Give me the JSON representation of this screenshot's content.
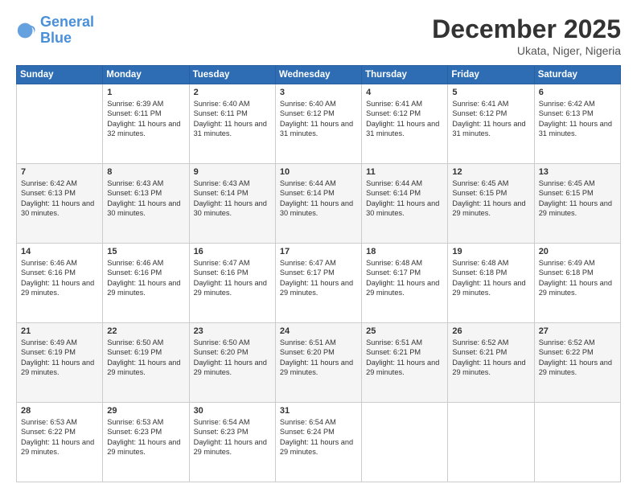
{
  "header": {
    "logo_line1": "General",
    "logo_line2": "Blue",
    "month_title": "December 2025",
    "location": "Ukata, Niger, Nigeria"
  },
  "weekdays": [
    "Sunday",
    "Monday",
    "Tuesday",
    "Wednesday",
    "Thursday",
    "Friday",
    "Saturday"
  ],
  "weeks": [
    [
      {
        "day": "",
        "sunrise": "",
        "sunset": "",
        "daylight": ""
      },
      {
        "day": "1",
        "sunrise": "Sunrise: 6:39 AM",
        "sunset": "Sunset: 6:11 PM",
        "daylight": "Daylight: 11 hours and 32 minutes."
      },
      {
        "day": "2",
        "sunrise": "Sunrise: 6:40 AM",
        "sunset": "Sunset: 6:11 PM",
        "daylight": "Daylight: 11 hours and 31 minutes."
      },
      {
        "day": "3",
        "sunrise": "Sunrise: 6:40 AM",
        "sunset": "Sunset: 6:12 PM",
        "daylight": "Daylight: 11 hours and 31 minutes."
      },
      {
        "day": "4",
        "sunrise": "Sunrise: 6:41 AM",
        "sunset": "Sunset: 6:12 PM",
        "daylight": "Daylight: 11 hours and 31 minutes."
      },
      {
        "day": "5",
        "sunrise": "Sunrise: 6:41 AM",
        "sunset": "Sunset: 6:12 PM",
        "daylight": "Daylight: 11 hours and 31 minutes."
      },
      {
        "day": "6",
        "sunrise": "Sunrise: 6:42 AM",
        "sunset": "Sunset: 6:13 PM",
        "daylight": "Daylight: 11 hours and 31 minutes."
      }
    ],
    [
      {
        "day": "7",
        "sunrise": "Sunrise: 6:42 AM",
        "sunset": "Sunset: 6:13 PM",
        "daylight": "Daylight: 11 hours and 30 minutes."
      },
      {
        "day": "8",
        "sunrise": "Sunrise: 6:43 AM",
        "sunset": "Sunset: 6:13 PM",
        "daylight": "Daylight: 11 hours and 30 minutes."
      },
      {
        "day": "9",
        "sunrise": "Sunrise: 6:43 AM",
        "sunset": "Sunset: 6:14 PM",
        "daylight": "Daylight: 11 hours and 30 minutes."
      },
      {
        "day": "10",
        "sunrise": "Sunrise: 6:44 AM",
        "sunset": "Sunset: 6:14 PM",
        "daylight": "Daylight: 11 hours and 30 minutes."
      },
      {
        "day": "11",
        "sunrise": "Sunrise: 6:44 AM",
        "sunset": "Sunset: 6:14 PM",
        "daylight": "Daylight: 11 hours and 30 minutes."
      },
      {
        "day": "12",
        "sunrise": "Sunrise: 6:45 AM",
        "sunset": "Sunset: 6:15 PM",
        "daylight": "Daylight: 11 hours and 29 minutes."
      },
      {
        "day": "13",
        "sunrise": "Sunrise: 6:45 AM",
        "sunset": "Sunset: 6:15 PM",
        "daylight": "Daylight: 11 hours and 29 minutes."
      }
    ],
    [
      {
        "day": "14",
        "sunrise": "Sunrise: 6:46 AM",
        "sunset": "Sunset: 6:16 PM",
        "daylight": "Daylight: 11 hours and 29 minutes."
      },
      {
        "day": "15",
        "sunrise": "Sunrise: 6:46 AM",
        "sunset": "Sunset: 6:16 PM",
        "daylight": "Daylight: 11 hours and 29 minutes."
      },
      {
        "day": "16",
        "sunrise": "Sunrise: 6:47 AM",
        "sunset": "Sunset: 6:16 PM",
        "daylight": "Daylight: 11 hours and 29 minutes."
      },
      {
        "day": "17",
        "sunrise": "Sunrise: 6:47 AM",
        "sunset": "Sunset: 6:17 PM",
        "daylight": "Daylight: 11 hours and 29 minutes."
      },
      {
        "day": "18",
        "sunrise": "Sunrise: 6:48 AM",
        "sunset": "Sunset: 6:17 PM",
        "daylight": "Daylight: 11 hours and 29 minutes."
      },
      {
        "day": "19",
        "sunrise": "Sunrise: 6:48 AM",
        "sunset": "Sunset: 6:18 PM",
        "daylight": "Daylight: 11 hours and 29 minutes."
      },
      {
        "day": "20",
        "sunrise": "Sunrise: 6:49 AM",
        "sunset": "Sunset: 6:18 PM",
        "daylight": "Daylight: 11 hours and 29 minutes."
      }
    ],
    [
      {
        "day": "21",
        "sunrise": "Sunrise: 6:49 AM",
        "sunset": "Sunset: 6:19 PM",
        "daylight": "Daylight: 11 hours and 29 minutes."
      },
      {
        "day": "22",
        "sunrise": "Sunrise: 6:50 AM",
        "sunset": "Sunset: 6:19 PM",
        "daylight": "Daylight: 11 hours and 29 minutes."
      },
      {
        "day": "23",
        "sunrise": "Sunrise: 6:50 AM",
        "sunset": "Sunset: 6:20 PM",
        "daylight": "Daylight: 11 hours and 29 minutes."
      },
      {
        "day": "24",
        "sunrise": "Sunrise: 6:51 AM",
        "sunset": "Sunset: 6:20 PM",
        "daylight": "Daylight: 11 hours and 29 minutes."
      },
      {
        "day": "25",
        "sunrise": "Sunrise: 6:51 AM",
        "sunset": "Sunset: 6:21 PM",
        "daylight": "Daylight: 11 hours and 29 minutes."
      },
      {
        "day": "26",
        "sunrise": "Sunrise: 6:52 AM",
        "sunset": "Sunset: 6:21 PM",
        "daylight": "Daylight: 11 hours and 29 minutes."
      },
      {
        "day": "27",
        "sunrise": "Sunrise: 6:52 AM",
        "sunset": "Sunset: 6:22 PM",
        "daylight": "Daylight: 11 hours and 29 minutes."
      }
    ],
    [
      {
        "day": "28",
        "sunrise": "Sunrise: 6:53 AM",
        "sunset": "Sunset: 6:22 PM",
        "daylight": "Daylight: 11 hours and 29 minutes."
      },
      {
        "day": "29",
        "sunrise": "Sunrise: 6:53 AM",
        "sunset": "Sunset: 6:23 PM",
        "daylight": "Daylight: 11 hours and 29 minutes."
      },
      {
        "day": "30",
        "sunrise": "Sunrise: 6:54 AM",
        "sunset": "Sunset: 6:23 PM",
        "daylight": "Daylight: 11 hours and 29 minutes."
      },
      {
        "day": "31",
        "sunrise": "Sunrise: 6:54 AM",
        "sunset": "Sunset: 6:24 PM",
        "daylight": "Daylight: 11 hours and 29 minutes."
      },
      {
        "day": "",
        "sunrise": "",
        "sunset": "",
        "daylight": ""
      },
      {
        "day": "",
        "sunrise": "",
        "sunset": "",
        "daylight": ""
      },
      {
        "day": "",
        "sunrise": "",
        "sunset": "",
        "daylight": ""
      }
    ]
  ]
}
